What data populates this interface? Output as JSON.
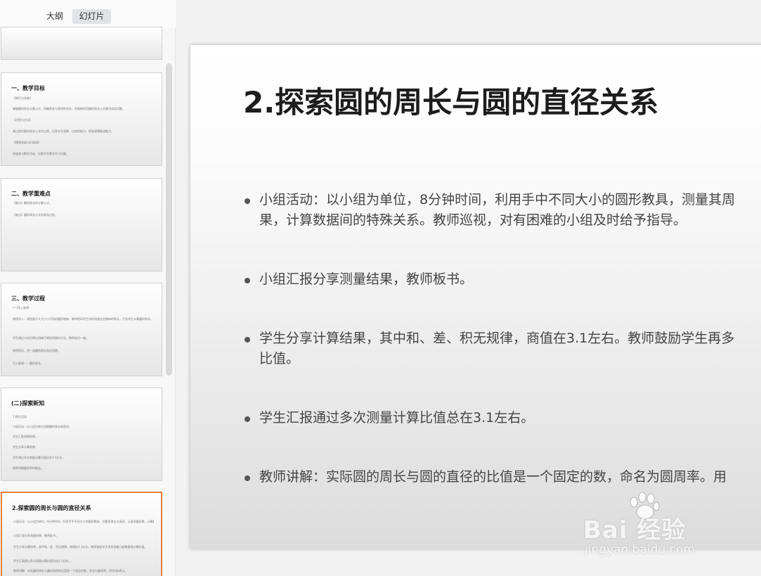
{
  "tabs": {
    "outline": "大纲",
    "slides": "幻灯片"
  },
  "thumbnails": [
    {
      "title": "",
      "lines": []
    },
    {
      "title": "一、教学目标",
      "lines": [
        "【知识与技能】",
        "掌握圆的周长计算公式，明确周长与直径的关系，并能够利用圆的周长公式解决实际问题。",
        "【过程与方法】",
        "通过探究圆的周长公式的过程，培养学生观察、比较的能力，提高逻辑推理能力。",
        "【情感态度与价值观】",
        "积极参与数学活动，培养学生数学学习兴趣。"
      ]
    },
    {
      "title": "二、教学重难点",
      "lines": [
        "【重点】圆的周长的计算公式。",
        "【难点】圆的周长公式的推导过程。"
      ]
    },
    {
      "title": "三、教学过程",
      "lines": [
        "(一)导入新课",
        "情境导入：课堂展示大大小小不同的圆形物体，教师提问学生如何测量这些物体的周长，引导学生计算圆的周长。",
        "学生通过讨论后得出用绳子缠绕测量的方法，教师追问一遍。",
        "教师提问，是一道圆的周长的应用题。",
        "引入新课——圆的周长。"
      ]
    },
    {
      "title": "(二)探索新知",
      "lines": [
        "1.探究活动",
        "小组活动：以小组为单位测量圆的周长和直径。",
        "学生汇报测量结果。",
        "学生分享计算结果。",
        "学生通过多次测量计算比值总在3.1左右。",
        "教师讲解圆周率的概念。"
      ]
    },
    {
      "title": "2.探索圆的周长与圆的直径关系",
      "lines": [
        "小组活动：以小组为单位，8分钟时间，利用手中不同大小的圆形教具，测量其周长与直径，记录测量结果，计算数据间的特殊关系。",
        "小组汇报分享测量结果，教师板书。",
        "学生分享计算结果，其中和、差、积无规律，商值在3.1左右。教师鼓励学生再多测量几组数据再计算比值。",
        "学生汇报通过多次测量计算比值总在3.1左右。",
        "教师讲解：实际圆的周长与圆的直径的比值是一个固定的数，命名为圆周率。用字母π表示。"
      ]
    }
  ],
  "slide": {
    "title": "2.探索圆的周长与圆的直径关系",
    "bullets": [
      {
        "line1": "小组活动：以小组为单位，8分钟时间，利用手中不同大小的圆形教具，测量其周",
        "line2": "果，计算数据间的特殊关系。教师巡视，对有困难的小组及时给予指导。"
      },
      {
        "line1": "小组汇报分享测量结果，教师板书。",
        "line2": ""
      },
      {
        "line1": "学生分享计算结果，其中和、差、积无规律，商值在3.1左右。教师鼓励学生再多",
        "line2": "比值。"
      },
      {
        "line1": "学生汇报通过多次测量计算比值总在3.1左右。",
        "line2": ""
      },
      {
        "line1": "教师讲解：实际圆的周长与圆的直径的比值是一个固定的数，命名为圆周率。用",
        "line2": ""
      }
    ]
  },
  "watermark": {
    "brand": "Bai  经验",
    "url": "jingyan.baidu.com"
  },
  "colors": {
    "active_border": "#e8803a"
  }
}
